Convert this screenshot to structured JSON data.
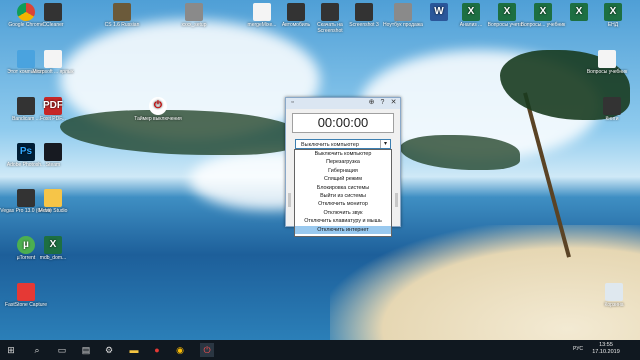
{
  "desktop_icons": [
    {
      "id": "chrome",
      "label": "Google Chrome",
      "glyph": "",
      "style": "chrome"
    },
    {
      "id": "ccleaner",
      "label": "CCleaner",
      "glyph": "",
      "style": "dark"
    },
    {
      "id": "cs",
      "label": "CS 1.6 Russian",
      "glyph": "",
      "style": "cs"
    },
    {
      "id": "setup",
      "label": "xxxx_setup",
      "glyph": "",
      "style": "app"
    },
    {
      "id": "merge",
      "label": "mergeMixe...",
      "glyph": "",
      "style": "doc"
    },
    {
      "id": "autosave",
      "label": "Автомобиль",
      "glyph": "",
      "style": "dark"
    },
    {
      "id": "screenshot",
      "label": "Скачать на Screenshot",
      "glyph": "",
      "style": "dark"
    },
    {
      "id": "screenshot3",
      "label": "Screenshot 3",
      "glyph": "",
      "style": "dark"
    },
    {
      "id": "notebook",
      "label": "Ноутбук продажа",
      "glyph": "",
      "style": "app"
    },
    {
      "id": "word1",
      "label": "",
      "glyph": "W",
      "style": "word"
    },
    {
      "id": "xl1",
      "label": "Анализ ...",
      "glyph": "X",
      "style": "excel"
    },
    {
      "id": "xl2",
      "label": "Вопросы учета...",
      "glyph": "X",
      "style": "excel"
    },
    {
      "id": "xl3",
      "label": "Вопросы... учебник",
      "glyph": "X",
      "style": "excel"
    },
    {
      "id": "xl4",
      "label": "",
      "glyph": "X",
      "style": "excel"
    },
    {
      "id": "xl5",
      "label": "ЕНД",
      "glyph": "X",
      "style": "excel"
    },
    {
      "id": "pc",
      "label": "Этот компьютер",
      "glyph": "",
      "style": "pc"
    },
    {
      "id": "msoffice",
      "label": "Microsoft ... ярлык",
      "glyph": "",
      "style": "doc"
    },
    {
      "id": "yxlsx",
      "label": "Вопросы учебник",
      "glyph": "",
      "style": "doc"
    },
    {
      "id": "bandicam",
      "label": "Bandicam ...",
      "glyph": "",
      "style": "dark"
    },
    {
      "id": "pdf",
      "label": "Foxit PDF...",
      "glyph": "PDF",
      "style": "pdf"
    },
    {
      "id": "timer",
      "label": "Таймер выключения",
      "glyph": "⏻",
      "style": "timer"
    },
    {
      "id": "books",
      "label": "Книги",
      "glyph": "",
      "style": "dark"
    },
    {
      "id": "ps",
      "label": "Adobe Photosh...",
      "glyph": "Ps",
      "style": "ps"
    },
    {
      "id": "steam",
      "label": "Steam",
      "glyph": "",
      "style": "steam"
    },
    {
      "id": "vegas",
      "label": "Vegas Pro 13.0 (64-bit)",
      "glyph": "",
      "style": "dark"
    },
    {
      "id": "movies",
      "label": "Movie Studio",
      "glyph": "",
      "style": "folder"
    },
    {
      "id": "utorrent",
      "label": "µTorrent",
      "glyph": "µ",
      "style": "green"
    },
    {
      "id": "xl6",
      "label": "mdb_dom...",
      "glyph": "X",
      "style": "excel"
    },
    {
      "id": "faststone",
      "label": "FastStone Capture",
      "glyph": "",
      "style": "fs"
    },
    {
      "id": "bin",
      "label": "Корзина",
      "glyph": "",
      "style": "bin"
    }
  ],
  "timer_window": {
    "time": "00:00:00",
    "selected_action": "Выключить компьютер",
    "options": [
      "Выключить компьютер",
      "Перезагрузка",
      "Гибернация",
      "Спящий режим",
      "Блокировка системы",
      "Выйти из системы",
      "Отключить монитор",
      "Отключить звук",
      "Отключить клавиатуру и мышь",
      "Отключить интернет"
    ],
    "highlighted_option_index": 9
  },
  "taskbar": {
    "items": [
      "windows-start",
      "search",
      "task-view",
      "calculator",
      "settings",
      "explorer",
      "yandex",
      "chrome",
      "timer"
    ],
    "lang": "РУС",
    "time": "13:55",
    "date": "17.10.2019"
  },
  "colors": {
    "taskbar": "#101820",
    "highlight": "#99c9ef"
  }
}
